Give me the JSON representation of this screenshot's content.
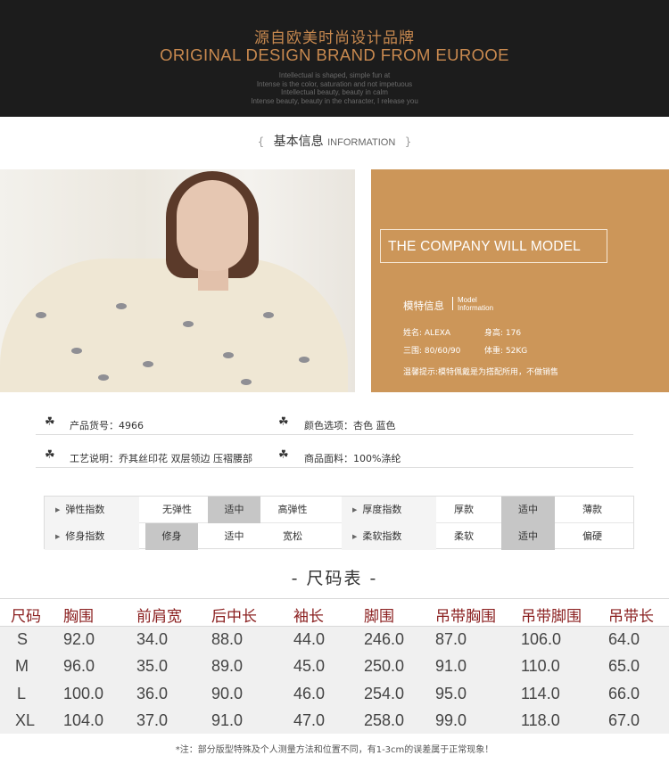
{
  "banner": {
    "title_cn": "源自欧美时尚设计品牌",
    "title_en": "ORIGINAL DESIGN BRAND FROM EUROOE",
    "lines": [
      "Intellectual is shaped, simple fun at",
      "Intense is the color, saturation and not impetuous",
      "Intellectual beauty, beauty in calm",
      "Intense beauty, beauty in the character, I release you"
    ]
  },
  "section": {
    "brace_left": "{",
    "title_cn": "基本信息",
    "title_en": "INFORMATION",
    "brace_right": "}"
  },
  "model": {
    "box_text": "THE COMPANY WILL MODEL",
    "heading_cn": "模特信息",
    "heading_en_1": "Model",
    "heading_en_2": "Information",
    "name": "姓名: ALEXA",
    "height": "身高: 176",
    "measurements": "三围: 80/60/90",
    "weight": "体重: 52KG",
    "tip": "温馨提示:模特佩戴是为搭配所用，不做销售"
  },
  "product": {
    "trefoil": "☘",
    "item_no": "产品货号：4966",
    "colors": "颜色选项：杏色  蓝色",
    "craft": "工艺说明：乔其丝印花  双层领边  压褶腰部",
    "fabric": "商品面料：100%涤纶"
  },
  "indices": [
    {
      "label": "弹性指数",
      "options": [
        "无弹性",
        "适中",
        "高弹性"
      ],
      "selected": 1
    },
    {
      "label": "厚度指数",
      "options": [
        "厚款",
        "适中",
        "薄款"
      ],
      "selected": 1
    },
    {
      "label": "修身指数",
      "options": [
        "修身",
        "适中",
        "宽松"
      ],
      "selected": 0
    },
    {
      "label": "柔软指数",
      "options": [
        "柔软",
        "适中",
        "偏硬"
      ],
      "selected": 1
    }
  ],
  "size_chart": {
    "title": "- 尺码表 -",
    "headers": [
      "尺码",
      "胸围",
      "前肩宽",
      "后中长",
      "袖长",
      "脚围",
      "吊带胸围",
      "吊带脚围",
      "吊带长"
    ],
    "rows": [
      [
        "S",
        "92.0",
        "34.0",
        "88.0",
        "44.0",
        "246.0",
        "87.0",
        "106.0",
        "64.0"
      ],
      [
        "M",
        "96.0",
        "35.0",
        "89.0",
        "45.0",
        "250.0",
        "91.0",
        "110.0",
        "65.0"
      ],
      [
        "L",
        "100.0",
        "36.0",
        "90.0",
        "46.0",
        "254.0",
        "95.0",
        "114.0",
        "66.0"
      ],
      [
        "XL",
        "104.0",
        "37.0",
        "91.0",
        "47.0",
        "258.0",
        "99.0",
        "118.0",
        "67.0"
      ]
    ],
    "note": "*注：部分版型特殊及个人测量方法和位置不同，有1-3cm的误差属于正常现象！"
  },
  "colors": {
    "banner_bg": "#1c1c1c",
    "banner_gold": "#c8894f",
    "model_panel": "#cc9659",
    "size_header": "#8b2020",
    "selected_cell": "#c6c6c6"
  }
}
